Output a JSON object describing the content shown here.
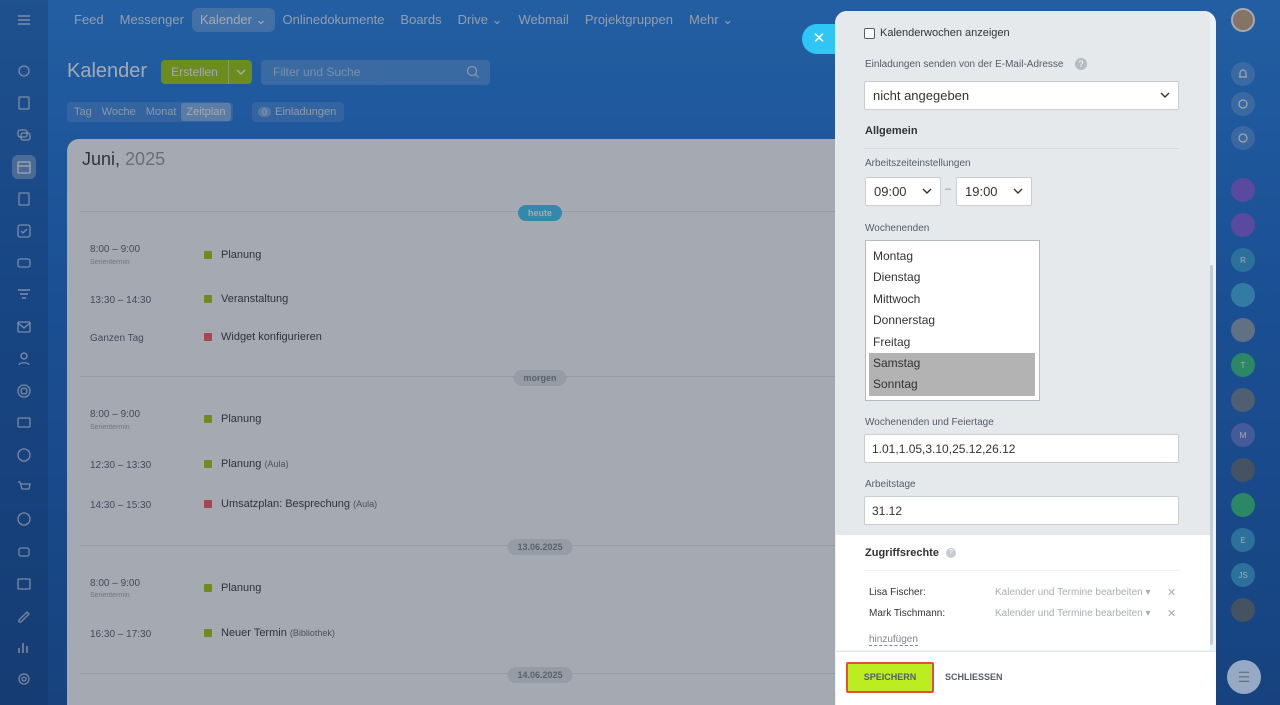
{
  "nav": [
    "Feed",
    "Messenger",
    "Kalender",
    "Onlinedokumente",
    "Boards",
    "Drive",
    "Webmail",
    "Projektgruppen",
    "Mehr"
  ],
  "page_title": "Kalender",
  "create_label": "Erstellen",
  "search_placeholder": "Filter und Suche",
  "view_tabs": [
    "Tag",
    "Woche",
    "Monat",
    "Zeitplan"
  ],
  "invites": {
    "count": "0",
    "label": "Einladungen"
  },
  "calendar": {
    "month": "Juni,",
    "year": "2025",
    "day_labels": [
      "heute",
      "morgen",
      "13.06.2025",
      "14.06.2025"
    ],
    "events": [
      {
        "time": "8:00 – 9:00",
        "sub": "Serientermin",
        "title": "Planung",
        "loc": "",
        "color": "#9dcf00"
      },
      {
        "time": "13:30 – 14:30",
        "sub": "",
        "title": "Veranstaltung",
        "loc": "",
        "color": "#9dcf00"
      },
      {
        "time": "Ganzen Tag",
        "sub": "",
        "title": "Widget konfigurieren",
        "loc": "",
        "color": "#ff5752"
      },
      {
        "time": "8:00 – 9:00",
        "sub": "Serientermin",
        "title": "Planung",
        "loc": "",
        "color": "#9dcf00"
      },
      {
        "time": "12:30 – 13:30",
        "sub": "",
        "title": "Planung",
        "loc": "(Aula)",
        "color": "#9dcf00"
      },
      {
        "time": "14:30 – 15:30",
        "sub": "",
        "title": "Umsatzplan: Besprechung",
        "loc": "(Aula)",
        "color": "#ff5752"
      },
      {
        "time": "8:00 – 9:00",
        "sub": "Serientermin",
        "title": "Planung",
        "loc": "",
        "color": "#9dcf00"
      },
      {
        "time": "16:30 – 17:30",
        "sub": "",
        "title": "Neuer Termin",
        "loc": "(Bibliothek)",
        "color": "#9dcf00"
      }
    ]
  },
  "settings": {
    "week_numbers_label": "Kalenderwochen anzeigen",
    "invite_email_label": "Einladungen senden von der E-Mail-Adresse",
    "invite_email_value": "nicht angegeben",
    "general_title": "Allgemein",
    "work_hours_label": "Arbeitszeiteinstellungen",
    "work_start": "09:00",
    "work_end": "19:00",
    "dash": "–",
    "weekends_label": "Wochenenden",
    "days": [
      "Montag",
      "Dienstag",
      "Mittwoch",
      "Donnerstag",
      "Freitag",
      "Samstag",
      "Sonntag"
    ],
    "holidays_label": "Wochenenden und Feiertage",
    "holidays_value": "1.01,1.05,3.10,25.12,26.12",
    "workdays_label": "Arbeitstage",
    "workdays_value": "31.12",
    "access_title": "Zugriffsrechte",
    "access": [
      {
        "name": "Lisa Fischer:",
        "perm": "Kalender und Termine bearbeiten"
      },
      {
        "name": "Mark Tischmann:",
        "perm": "Kalender und Termine bearbeiten"
      }
    ],
    "add_label": "hinzufügen"
  },
  "footer": {
    "save": "SPEICHERN",
    "close": "SCHLIESSEN"
  },
  "right_avatars": [
    "R",
    "T",
    "M",
    "E",
    "JS"
  ],
  "colors": {
    "accent_green": "#9dcf00",
    "today_blue": "#3bc8f5",
    "save_green": "#bbed21",
    "highlight": "#e74c3c"
  }
}
